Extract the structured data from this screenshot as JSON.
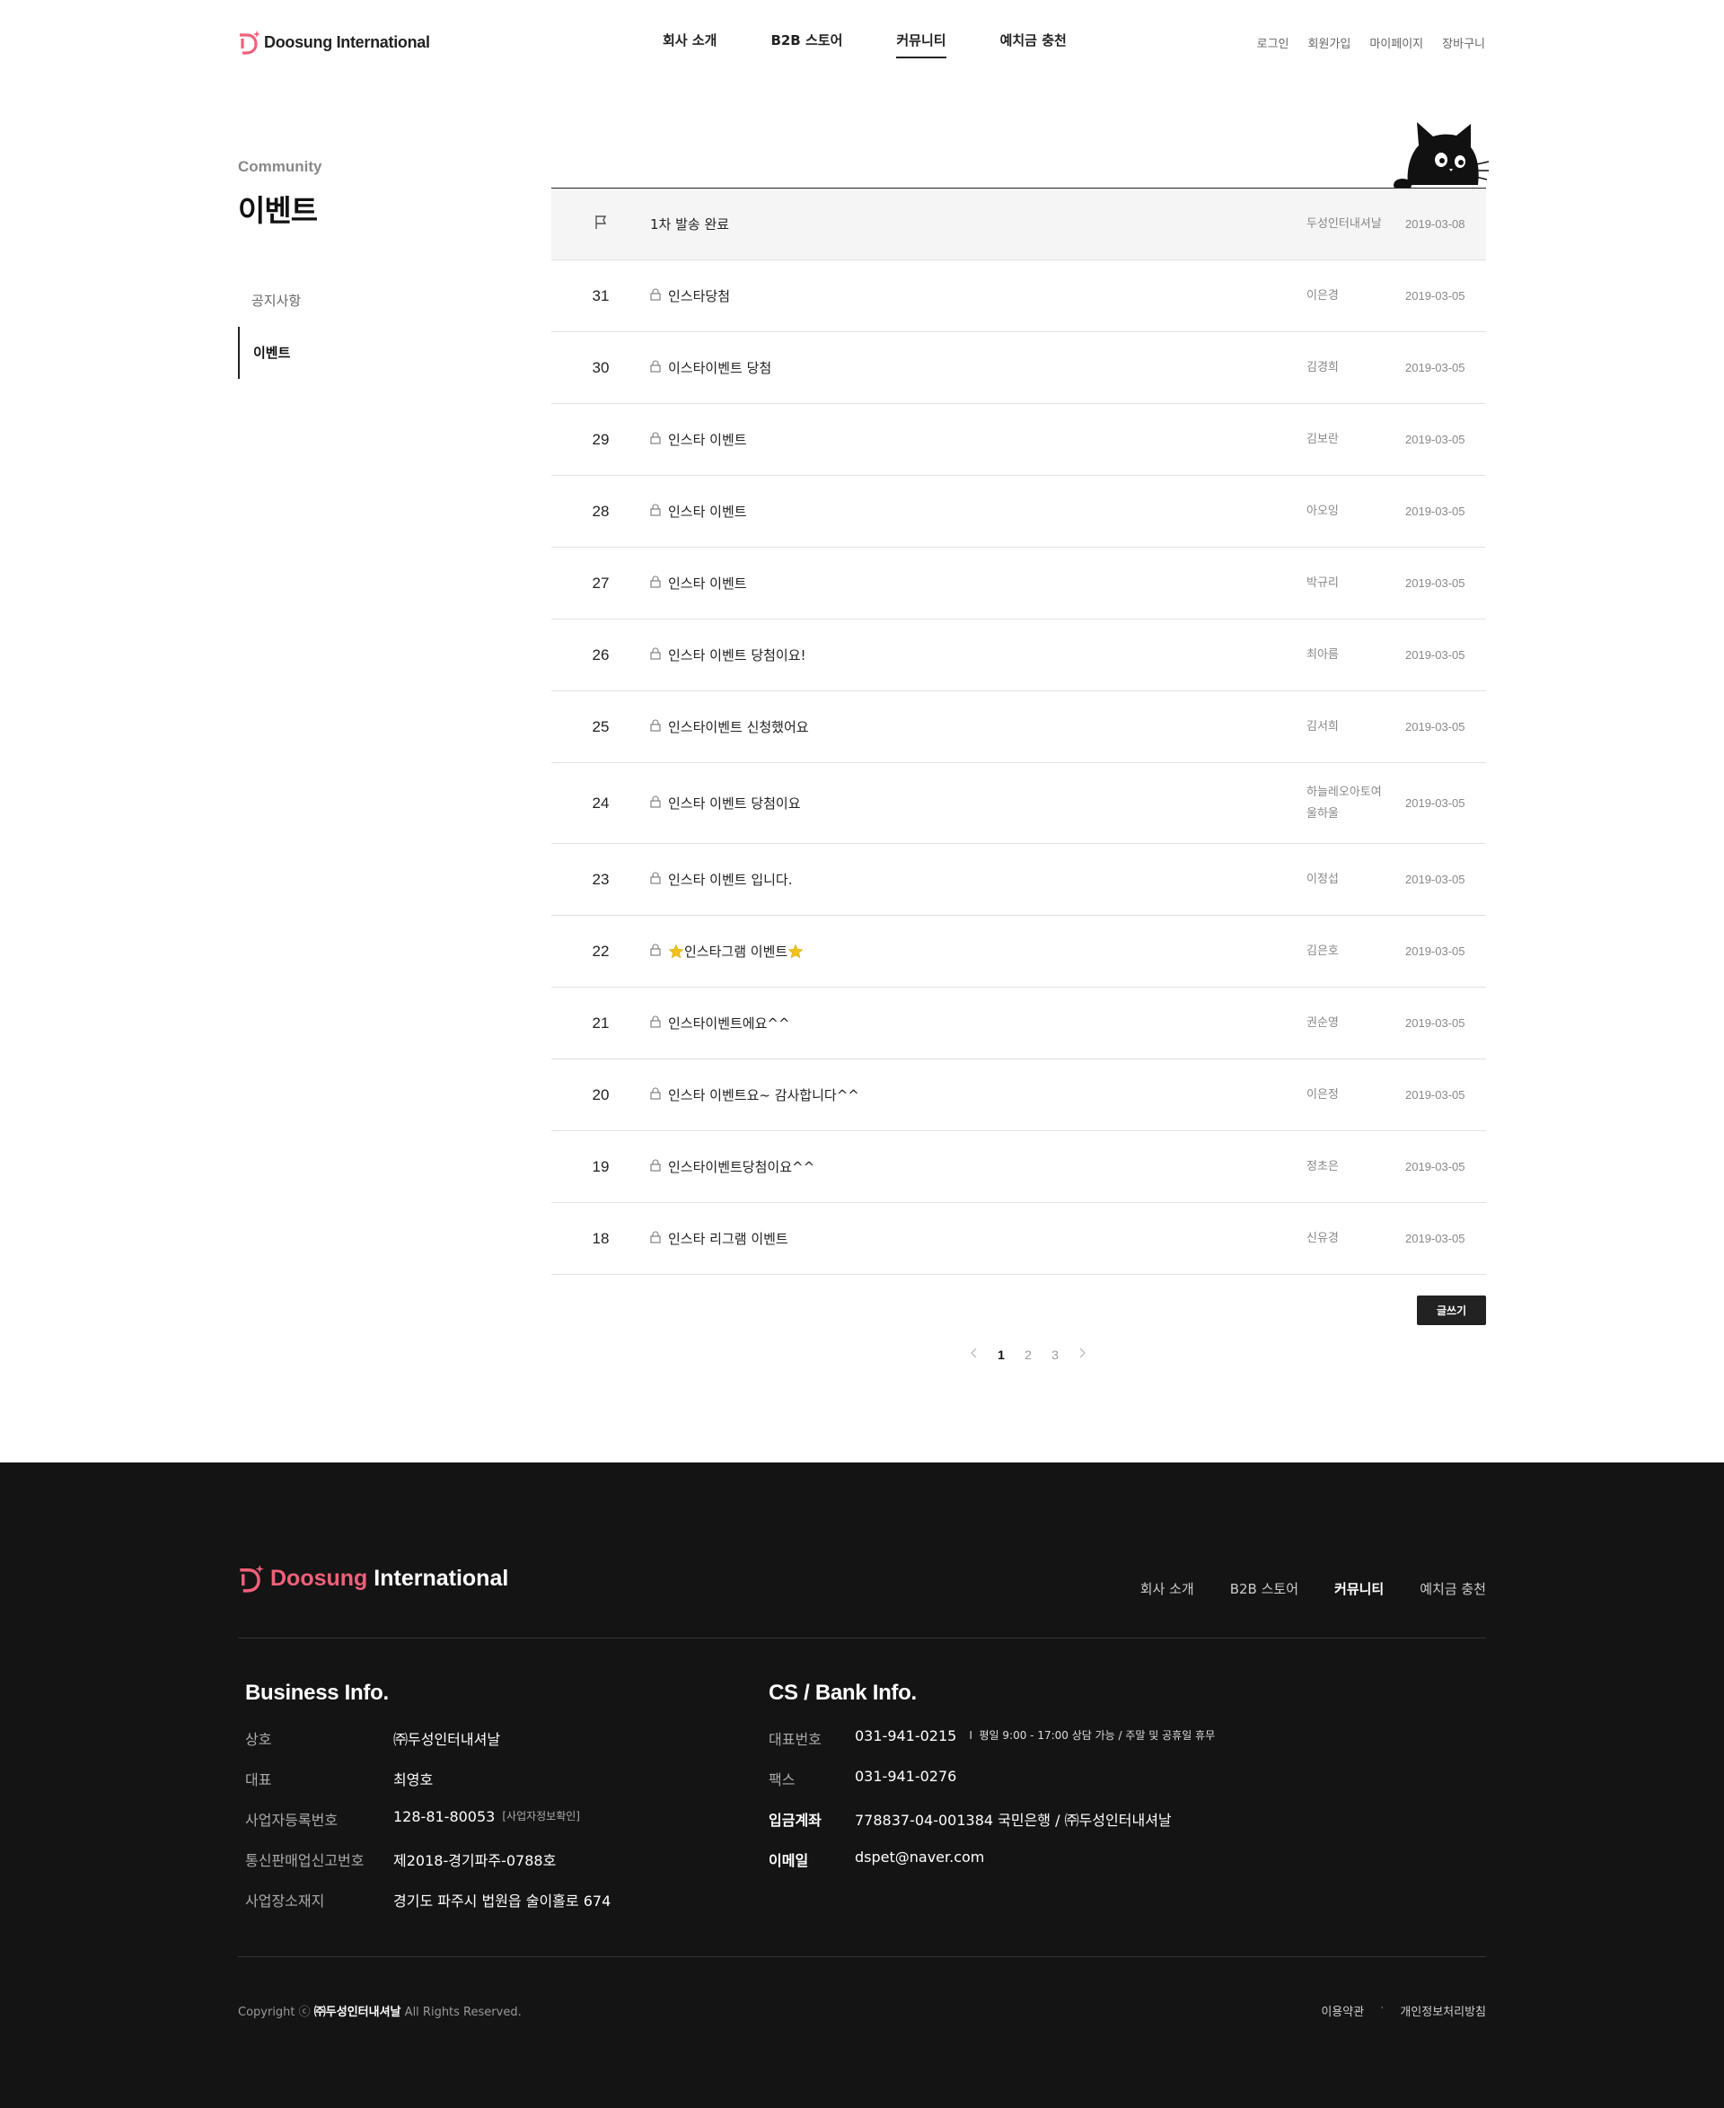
{
  "header": {
    "logo_text": "Doosung International",
    "nav": [
      "회사 소개",
      "B2B 스토어",
      "커뮤니티",
      "예치금 충천"
    ],
    "util": [
      "로그인",
      "회원가입",
      "마이페이지",
      "장바구니"
    ]
  },
  "lnb": {
    "sub": "Community",
    "title": "이벤트",
    "items": [
      "공지사항",
      "이벤트"
    ]
  },
  "board": {
    "notice": {
      "title": "1차 발송 완료",
      "writer": "두성인터내셔날",
      "date": "2019-03-08"
    },
    "rows": [
      {
        "num": "31",
        "title": "인스타당첨",
        "writer": "이은경",
        "date": "2019-03-05"
      },
      {
        "num": "30",
        "title": "이스타이벤트 당첨",
        "writer": "김경희",
        "date": "2019-03-05"
      },
      {
        "num": "29",
        "title": "인스타 이벤트",
        "writer": "김보란",
        "date": "2019-03-05"
      },
      {
        "num": "28",
        "title": "인스타 이벤트",
        "writer": "아오잉",
        "date": "2019-03-05"
      },
      {
        "num": "27",
        "title": "인스타 이벤트",
        "writer": "박규리",
        "date": "2019-03-05"
      },
      {
        "num": "26",
        "title": "인스타 이벤트 당첨이요!",
        "writer": "최아름",
        "date": "2019-03-05"
      },
      {
        "num": "25",
        "title": "인스타이벤트 신청했어요",
        "writer": "김서희",
        "date": "2019-03-05"
      },
      {
        "num": "24",
        "title": "인스타 이벤트 당첨이요",
        "writer": "하늘레오아토여울하울",
        "date": "2019-03-05"
      },
      {
        "num": "23",
        "title": "인스타 이벤트 입니다.",
        "writer": "이정섭",
        "date": "2019-03-05"
      },
      {
        "num": "22",
        "title": "인스타그램 이벤트",
        "writer": "김은호",
        "date": "2019-03-05"
      },
      {
        "num": "21",
        "title": "인스타이벤트에요^^",
        "writer": "권순영",
        "date": "2019-03-05"
      },
      {
        "num": "20",
        "title": "인스타 이벤트요~ 감사합니다^^",
        "writer": "이은정",
        "date": "2019-03-05"
      },
      {
        "num": "19",
        "title": "인스타이벤트당첨이요^^",
        "writer": "정초은",
        "date": "2019-03-05"
      },
      {
        "num": "18",
        "title": "인스타 리그램 이벤트",
        "writer": "신유경",
        "date": "2019-03-05"
      }
    ],
    "writer_24_line1": "하늘레오아토여",
    "writer_24_line2": "울하울",
    "write_button": "글쓰기",
    "pages": [
      "1",
      "2",
      "3"
    ]
  },
  "footer": {
    "logo_pink": "Doosung",
    "logo_white": "International",
    "nav": [
      "회사 소개",
      "B2B 스토어",
      "커뮤니티",
      "예치금 충천"
    ],
    "business_title": "Business Info.",
    "business": [
      {
        "k": "상호",
        "v": "㈜두성인터내셔날"
      },
      {
        "k": "대표",
        "v": "최영호"
      },
      {
        "k": "사업자등록번호",
        "v": "128-81-80053",
        "extra": "[사업자정보확인]"
      },
      {
        "k": "통신판매업신고번호",
        "v": "제2018-경기파주-0788호"
      },
      {
        "k": "사업장소재지",
        "v": "경기도 파주시 법원읍 술이홀로 674"
      }
    ],
    "cs_title": "CS / Bank Info.",
    "cs": [
      {
        "k": "대표번호",
        "v": "031-941-0215",
        "extra": "평일 9:00 - 17:00 상담 가능 / 주말 및 공휴일 휴무"
      },
      {
        "k": "팩스",
        "v": "031-941-0276"
      },
      {
        "k": "입금계좌",
        "v": "778837-04-001384 국민은행 / ㈜두성인터내셔날"
      },
      {
        "k": "이메일",
        "v": "dspet@naver.com"
      }
    ],
    "copyright_prefix": "Copyright ⓒ",
    "copyright_company": "㈜두성인터내셔날",
    "copyright_suffix": "All Rights Reserved.",
    "links": [
      "이용약관",
      "개인정보처리방침"
    ]
  },
  "colors": {
    "accent": "#f0607a",
    "dark": "#141414",
    "star": "#f2c21b"
  }
}
